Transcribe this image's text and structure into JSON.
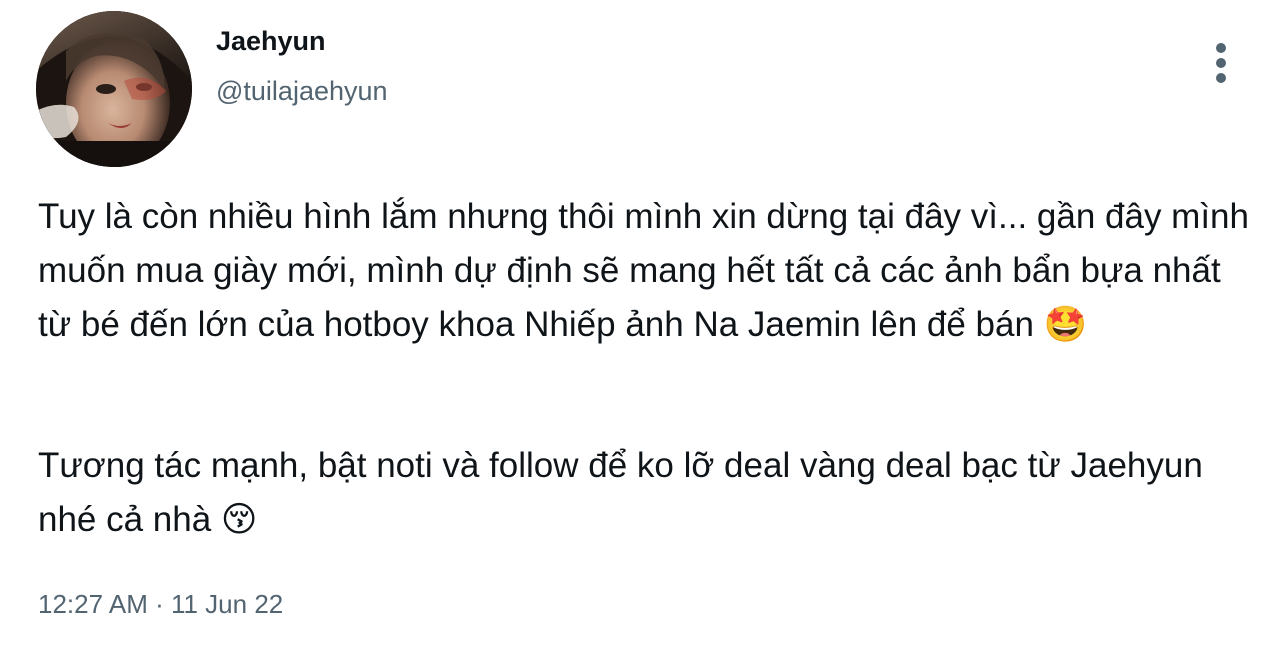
{
  "tweet": {
    "author": {
      "name": "Jaehyun",
      "handle": "@tuilajaehyun"
    },
    "more_icon": "more-vertical-icon",
    "paragraphs": [
      "Tuy là còn nhiều hình lắm nhưng thôi mình xin dừng tại đây vì... gần đây mình muốn mua giày mới, mình dự định sẽ mang hết tất cả các ảnh bẩn bựa nhất từ bé đến lớn của hotboy khoa Nhiếp ảnh Na Jaemin lên để bán 🤩",
      "Tương tác mạnh, bật noti và follow để ko lỡ deal vàng deal bạc từ Jaehyun nhé cả nhà 😚"
    ],
    "timestamp": "12:27 AM · 11 Jun 22"
  },
  "colors": {
    "text_primary": "#0f1419",
    "text_secondary": "#536471",
    "background": "#ffffff"
  }
}
